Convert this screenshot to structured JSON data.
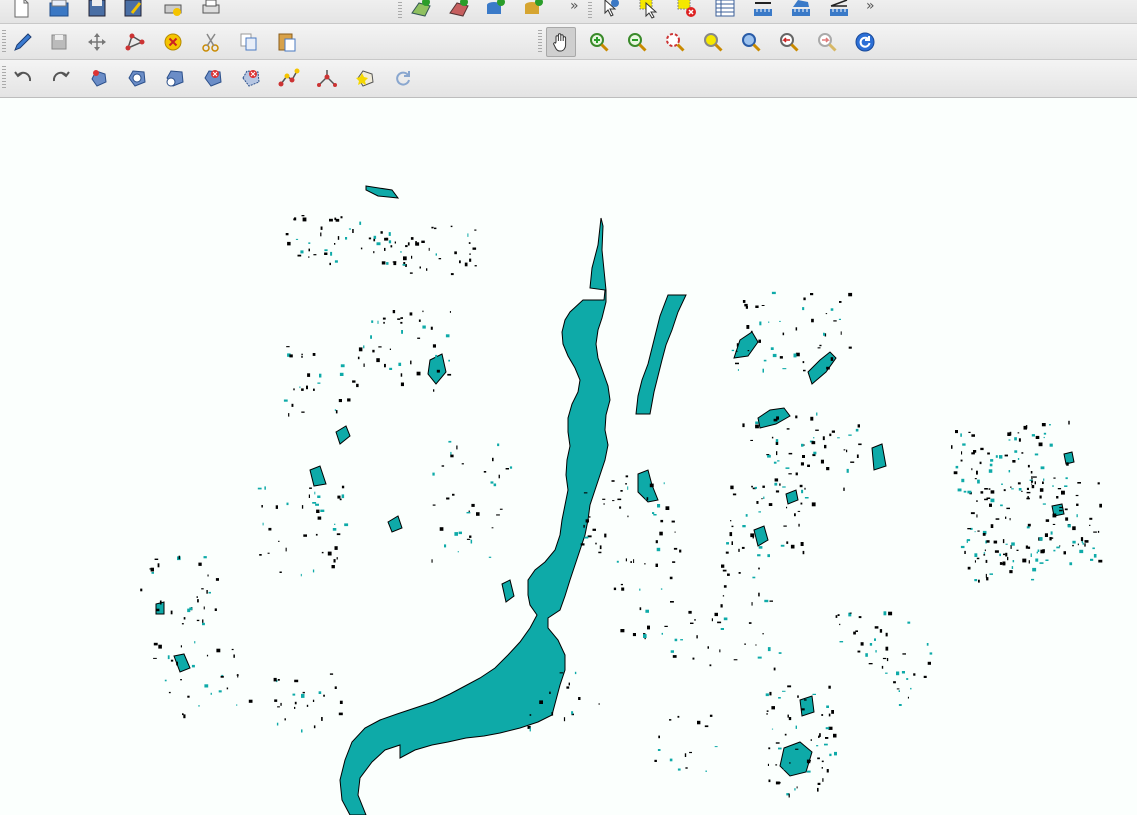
{
  "toolbar1": {
    "overflow_label": "»",
    "buttons": [
      {
        "name": "new-project-button",
        "icon": "new-document-icon"
      },
      {
        "name": "open-project-button",
        "icon": "open-folder-icon"
      },
      {
        "name": "save-project-button",
        "icon": "save-icon"
      },
      {
        "name": "save-as-button",
        "icon": "save-as-icon"
      },
      {
        "name": "print-composer-button",
        "icon": "composer-icon"
      },
      {
        "name": "print-button",
        "icon": "printer-icon"
      },
      {
        "name": "add-vector-layer-button",
        "icon": "add-vector-layer-icon"
      },
      {
        "name": "add-raster-layer-button",
        "icon": "add-raster-layer-icon"
      },
      {
        "name": "add-postgis-layer-button",
        "icon": "add-postgis-layer-icon"
      },
      {
        "name": "add-spatialite-layer-button",
        "icon": "add-spatialite-layer-icon"
      },
      {
        "name": "identify-features-button",
        "icon": "identify-icon"
      },
      {
        "name": "select-features-button",
        "icon": "select-icon"
      },
      {
        "name": "deselect-features-button",
        "icon": "deselect-icon"
      },
      {
        "name": "open-attribute-table-button",
        "icon": "attribute-table-icon"
      },
      {
        "name": "measure-line-button",
        "icon": "measure-line-icon"
      },
      {
        "name": "measure-area-button",
        "icon": "measure-area-icon"
      },
      {
        "name": "measure-angle-button",
        "icon": "measure-angle-icon"
      }
    ]
  },
  "toolbar2": {
    "buttons": [
      {
        "name": "toggle-editing-button",
        "icon": "pencil-icon"
      },
      {
        "name": "save-edits-button",
        "icon": "save-edits-icon"
      },
      {
        "name": "move-feature-button",
        "icon": "move-icon"
      },
      {
        "name": "node-tool-button",
        "icon": "node-tool-icon"
      },
      {
        "name": "delete-selected-button",
        "icon": "delete-icon"
      },
      {
        "name": "cut-features-button",
        "icon": "scissors-icon"
      },
      {
        "name": "copy-features-button",
        "icon": "copy-icon"
      },
      {
        "name": "paste-features-button",
        "icon": "paste-icon"
      },
      {
        "name": "pan-map-button",
        "icon": "hand-icon"
      },
      {
        "name": "zoom-in-button",
        "icon": "zoom-in-icon"
      },
      {
        "name": "zoom-out-button",
        "icon": "zoom-out-icon"
      },
      {
        "name": "zoom-full-button",
        "icon": "zoom-full-icon"
      },
      {
        "name": "zoom-to-selection-button",
        "icon": "zoom-selection-icon"
      },
      {
        "name": "zoom-to-layer-button",
        "icon": "zoom-layer-icon"
      },
      {
        "name": "zoom-last-button",
        "icon": "zoom-last-icon"
      },
      {
        "name": "zoom-next-button",
        "icon": "zoom-next-icon"
      },
      {
        "name": "refresh-button",
        "icon": "refresh-icon"
      }
    ]
  },
  "toolbar3": {
    "buttons": [
      {
        "name": "undo-button",
        "icon": "undo-icon"
      },
      {
        "name": "redo-button",
        "icon": "redo-icon"
      },
      {
        "name": "simplify-feature-button",
        "icon": "simplify-icon"
      },
      {
        "name": "add-ring-button",
        "icon": "add-ring-icon"
      },
      {
        "name": "add-part-button",
        "icon": "add-part-icon"
      },
      {
        "name": "delete-ring-button",
        "icon": "delete-ring-icon"
      },
      {
        "name": "delete-part-button",
        "icon": "delete-part-icon"
      },
      {
        "name": "reshape-features-button",
        "icon": "reshape-icon"
      },
      {
        "name": "split-features-button",
        "icon": "split-icon"
      },
      {
        "name": "merge-features-button",
        "icon": "merge-icon"
      },
      {
        "name": "rotate-point-symbols-button",
        "icon": "rotate-icon"
      }
    ]
  },
  "map": {
    "fill_color": "#0eaaa8",
    "stroke_color": "#000000",
    "background": "#fbfffd"
  }
}
